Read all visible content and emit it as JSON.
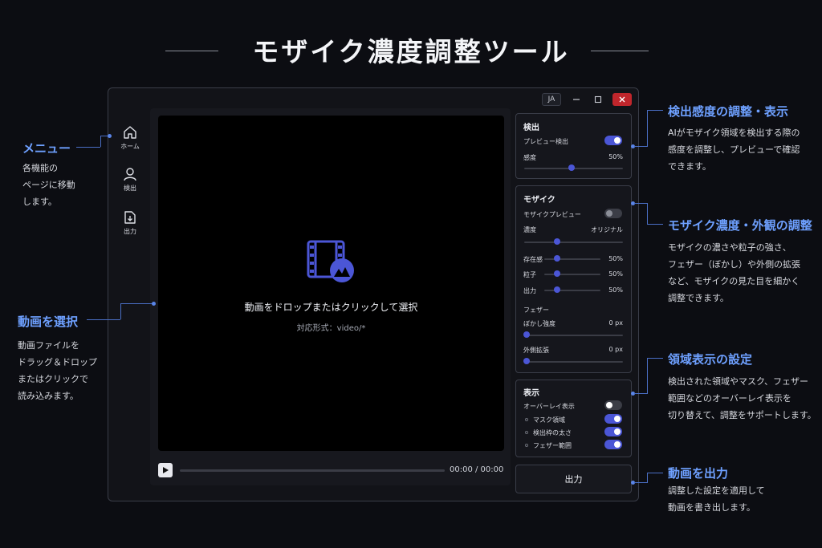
{
  "title": "モザイク濃度調整ツール",
  "colors": {
    "accent": "#4b56d6",
    "callout": "#6ea0ff",
    "close": "#c0262c",
    "bg": "#0c0d12"
  },
  "window": {
    "lang": "JA",
    "minimize_icon": "minimize-icon",
    "maximize_icon": "maximize-icon",
    "close_icon": "close-icon"
  },
  "sidebar": {
    "items": [
      {
        "label": "ホーム",
        "icon": "home-icon"
      },
      {
        "label": "検出",
        "icon": "person-icon"
      },
      {
        "label": "出力",
        "icon": "export-icon"
      }
    ]
  },
  "video": {
    "drop_text": "動画をドロップまたはクリックして選択",
    "formats": "対応形式：video/*",
    "time": "00:00 / 00:00",
    "icon": "video-file-icon"
  },
  "detection": {
    "heading": "検出",
    "preview_label": "プレビュー検出",
    "preview_on": true,
    "sensitivity_label": "感度",
    "sensitivity_value": "50%",
    "sensitivity": 0.5
  },
  "mosaic": {
    "heading": "モザイク",
    "preview_label": "モザイクプレビュー",
    "preview_on": false,
    "density_label": "濃度",
    "density_value": "オリジナル",
    "presence_label": "存在感",
    "presence_value": "50%",
    "grain_label": "粒子",
    "grain_value": "50%",
    "output_label": "出力",
    "output_value": "50%",
    "feather_heading": "フェザー",
    "blur_label": "ぼかし強度",
    "blur_value": "0 px",
    "expand_label": "外側拡張",
    "expand_value": "0 px"
  },
  "display": {
    "heading": "表示",
    "overlay_label": "オーバーレイ表示",
    "overlay_on": false,
    "mask_label": "マスク領域",
    "mask_on": true,
    "frame_label": "検出枠の太さ",
    "frame_on": true,
    "feather_label": "フェザー範囲",
    "feather_on": true
  },
  "export_label": "出力",
  "callouts": {
    "menu": {
      "title": "メニュー",
      "desc": "各機能の\nページに移動\nします。"
    },
    "select": {
      "title": "動画を選択",
      "desc": "動画ファイルを\nドラッグ＆ドロップ\nまたはクリックで\n読み込みます。"
    },
    "detect": {
      "title": "検出感度の調整・表示",
      "desc": "AIがモザイク領域を検出する際の\n感度を調整し、プレビューで確認\nできます。"
    },
    "mosaic": {
      "title": "モザイク濃度・外観の調整",
      "desc": "モザイクの濃さや粒子の強さ、\nフェザー（ぼかし）や外側の拡張\nなど、モザイクの見た目を細かく\n調整できます。"
    },
    "region": {
      "title": "領域表示の設定",
      "desc": "検出された領域やマスク、フェザー\n範囲などのオーバーレイ表示を\n切り替えて、調整をサポートします。"
    },
    "export": {
      "title": "動画を出力",
      "desc": "調整した設定を適用して\n動画を書き出します。"
    }
  }
}
